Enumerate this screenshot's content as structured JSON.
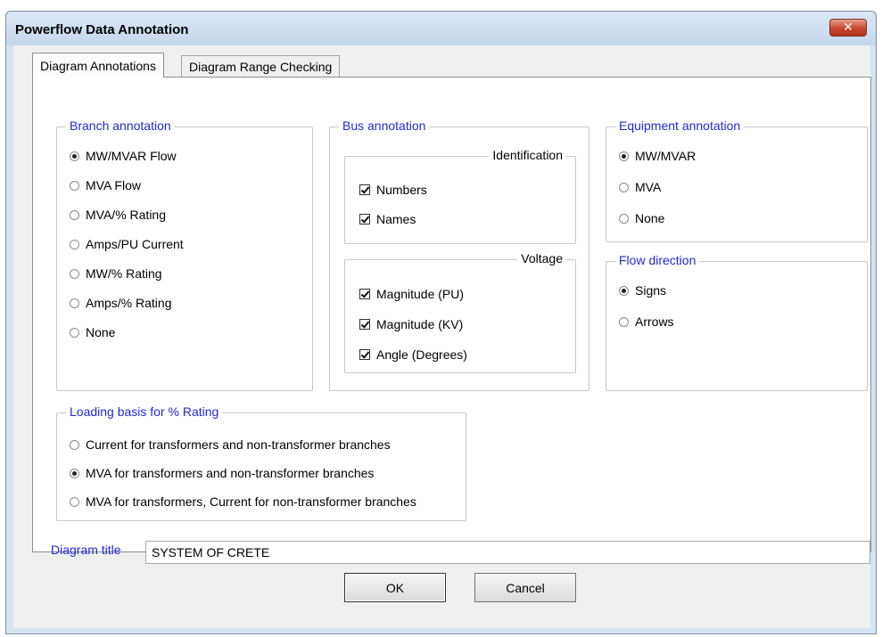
{
  "window": {
    "title": "Powerflow Data Annotation",
    "close_glyph": "✕"
  },
  "tabs": [
    {
      "label": "Diagram Annotations",
      "active": true
    },
    {
      "label": "Diagram Range Checking",
      "active": false
    }
  ],
  "branch_annotation": {
    "label": "Branch annotation",
    "options": [
      {
        "label": "MW/MVAR Flow",
        "selected": true
      },
      {
        "label": "MVA Flow",
        "selected": false
      },
      {
        "label": "MVA/% Rating",
        "selected": false
      },
      {
        "label": "Amps/PU Current",
        "selected": false
      },
      {
        "label": "MW/% Rating",
        "selected": false
      },
      {
        "label": "Amps/% Rating",
        "selected": false
      },
      {
        "label": "None",
        "selected": false
      }
    ]
  },
  "bus_annotation": {
    "label": "Bus annotation",
    "identification": {
      "label": "Identification",
      "options": [
        {
          "label": "Numbers",
          "checked": true
        },
        {
          "label": "Names",
          "checked": true
        }
      ]
    },
    "voltage": {
      "label": "Voltage",
      "options": [
        {
          "label": "Magnitude (PU)",
          "checked": true
        },
        {
          "label": "Magnitude (KV)",
          "checked": true
        },
        {
          "label": "Angle (Degrees)",
          "checked": true
        }
      ]
    }
  },
  "equipment_annotation": {
    "label": "Equipment annotation",
    "options": [
      {
        "label": "MW/MVAR",
        "selected": true
      },
      {
        "label": "MVA",
        "selected": false
      },
      {
        "label": "None",
        "selected": false
      }
    ]
  },
  "flow_direction": {
    "label": "Flow direction",
    "options": [
      {
        "label": "Signs",
        "selected": true
      },
      {
        "label": "Arrows",
        "selected": false
      }
    ]
  },
  "loading_basis": {
    "label": "Loading basis for % Rating",
    "options": [
      {
        "label": "Current for transformers and non-transformer branches",
        "selected": false
      },
      {
        "label": "MVA for transformers and non-transformer branches",
        "selected": true
      },
      {
        "label": "MVA for transformers, Current for non-transformer branches",
        "selected": false
      }
    ]
  },
  "diagram_title": {
    "label": "Diagram title",
    "value": "SYSTEM OF CRETE"
  },
  "buttons": {
    "ok": "OK",
    "cancel": "Cancel"
  }
}
